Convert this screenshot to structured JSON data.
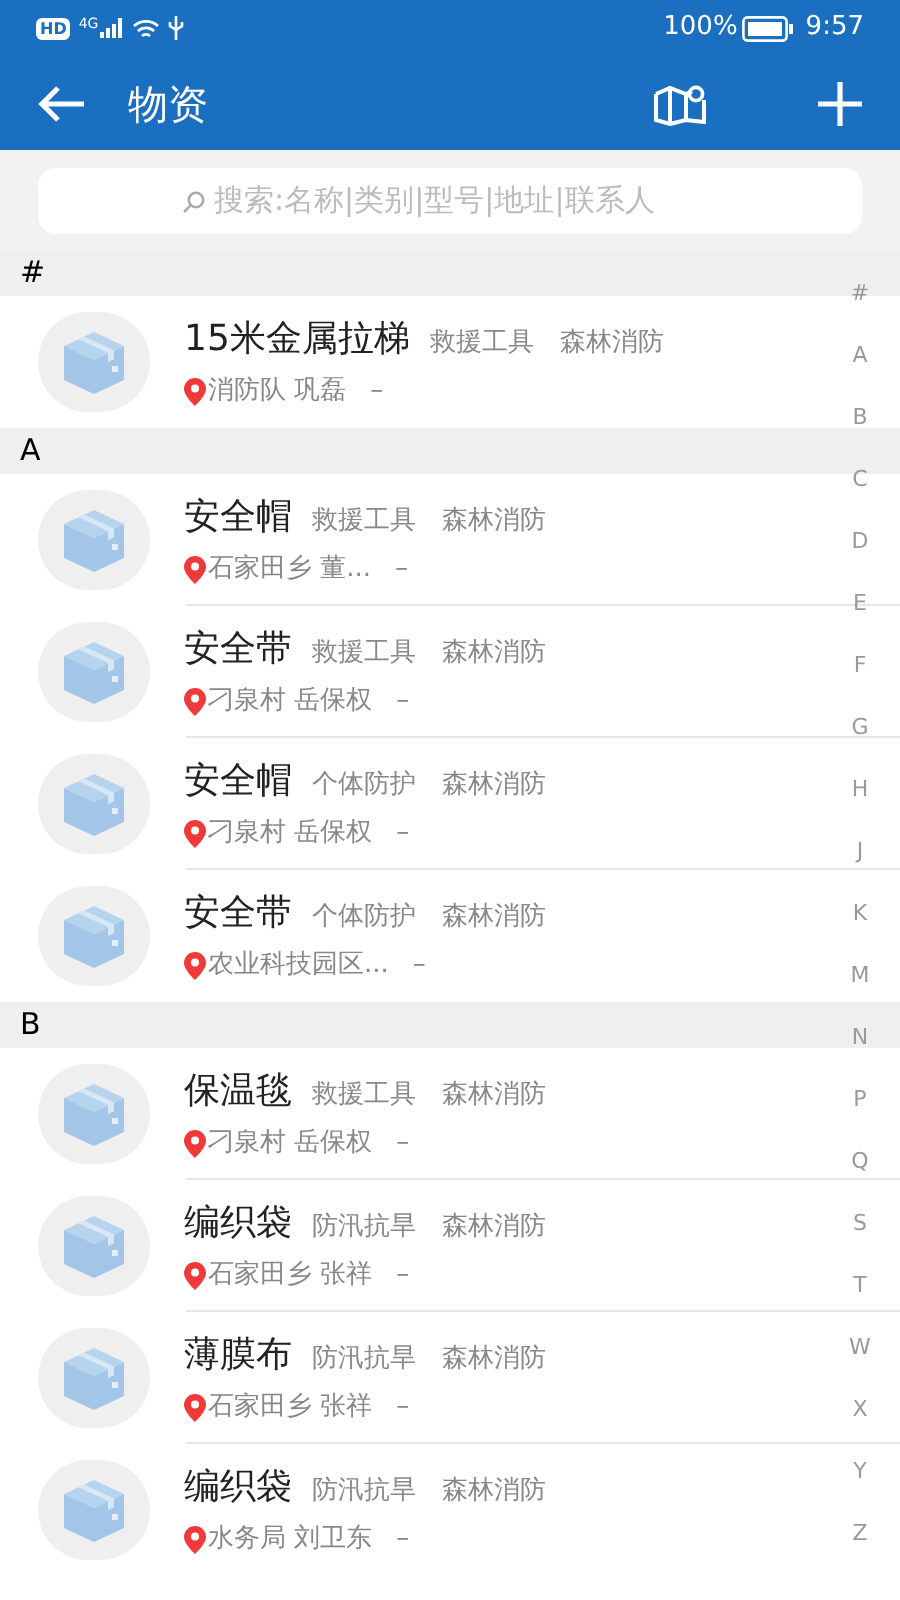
{
  "status_bar": {
    "hd": "HD",
    "network": "4G",
    "battery": "100%",
    "time": "9:57"
  },
  "app_bar": {
    "title": "物资"
  },
  "search": {
    "placeholder": "搜索:名称|类别|型号|地址|联系人"
  },
  "sections": [
    {
      "letter": "#",
      "items": [
        {
          "name": "15米金属拉梯",
          "category": "救援工具",
          "unit": "森林消防",
          "location": "消防队 巩磊",
          "phone": "–"
        }
      ]
    },
    {
      "letter": "A",
      "items": [
        {
          "name": "安全帽",
          "category": "救援工具",
          "unit": "森林消防",
          "location": "石家田乡 董...",
          "phone": "–"
        },
        {
          "name": "安全带",
          "category": "救援工具",
          "unit": "森林消防",
          "location": "刁泉村 岳保权",
          "phone": "–"
        },
        {
          "name": "安全帽",
          "category": "个体防护",
          "unit": "森林消防",
          "location": "刁泉村 岳保权",
          "phone": "–"
        },
        {
          "name": "安全带",
          "category": "个体防护",
          "unit": "森林消防",
          "location": "农业科技园区...",
          "phone": "–"
        }
      ]
    },
    {
      "letter": "B",
      "items": [
        {
          "name": "保温毯",
          "category": "救援工具",
          "unit": "森林消防",
          "location": "刁泉村 岳保权",
          "phone": "–"
        },
        {
          "name": "编织袋",
          "category": "防汛抗旱",
          "unit": "森林消防",
          "location": "石家田乡 张祥",
          "phone": "–"
        },
        {
          "name": "薄膜布",
          "category": "防汛抗旱",
          "unit": "森林消防",
          "location": "石家田乡 张祥",
          "phone": "–"
        },
        {
          "name": "编织袋",
          "category": "防汛抗旱",
          "unit": "森林消防",
          "location": "水务局 刘卫东",
          "phone": "–"
        }
      ]
    }
  ],
  "index_letters": [
    "#",
    "A",
    "B",
    "C",
    "D",
    "E",
    "F",
    "G",
    "H",
    "J",
    "K",
    "M",
    "N",
    "P",
    "Q",
    "S",
    "T",
    "W",
    "X",
    "Y",
    "Z"
  ]
}
